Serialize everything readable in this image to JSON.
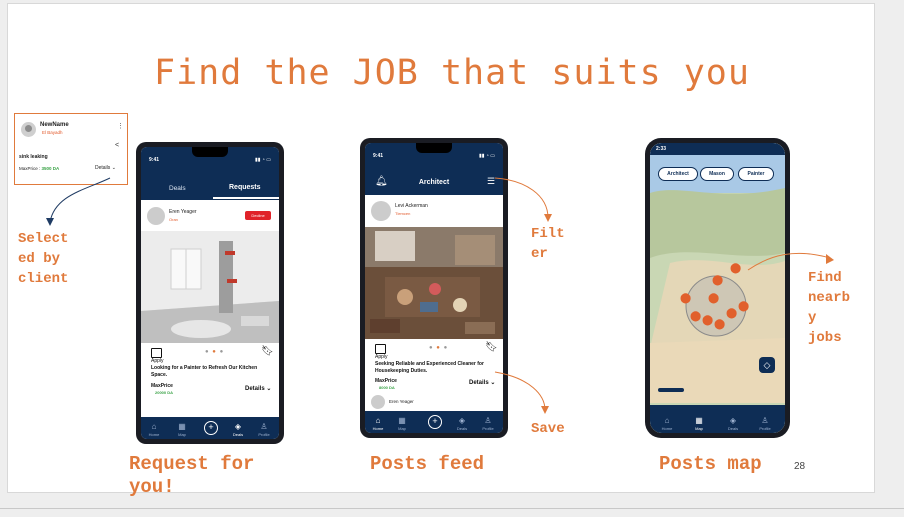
{
  "slide": {
    "title": "Find the JOB that suits you",
    "page_number": "28"
  },
  "card": {
    "name": "NewName",
    "city": "El Bayadh",
    "job": "sink leaking",
    "max_price_label": "MaxPrice :",
    "max_price_value": "3500 DA",
    "details": "Details",
    "caption": [
      "Select",
      "ed by",
      "client"
    ]
  },
  "phone1": {
    "time": "9:41",
    "tabs": [
      "Deals",
      "Requests"
    ],
    "user": "Eren Yeager",
    "user_city": "Oran",
    "decline": "Decline",
    "apply": "Apply",
    "post_text": "Looking for a Painter to Refresh Our Kitchen Space.",
    "max_price_label": "MaxPrice",
    "max_price_value": "20000 DA",
    "details": "Details",
    "nav": [
      "Home",
      "Map",
      "",
      "Deals",
      "Profile"
    ],
    "caption": [
      "Request for",
      "you!"
    ]
  },
  "phone2": {
    "time": "9:41",
    "header": "Architect",
    "user": "Levi Ackerman",
    "user_city": "Tlemcen",
    "apply": "Apply",
    "post_text": "Seeking Reliable and Experienced Cleaner for Housekeeping Duties.",
    "max_price_label": "MaxPrice",
    "max_price_value": "8000 DA",
    "details": "Details",
    "next_user": "Eren Yeager",
    "nav": [
      "Home",
      "Map",
      "",
      "Deals",
      "Profile"
    ],
    "caption": "Posts feed",
    "filter_label": [
      "Filt",
      "er"
    ],
    "save_label": "Save"
  },
  "phone3": {
    "time": "2:33",
    "chips": [
      "Architect",
      "Mason",
      "Painter"
    ],
    "nav": [
      "Home",
      "Map",
      "Deals",
      "Profile"
    ],
    "caption": "Posts map",
    "nearby_label": [
      "Find",
      "nearb",
      "y",
      "jobs"
    ]
  },
  "colors": {
    "accent": "#e07a3c",
    "navy": "#0e2d55",
    "decline_red": "#e0232a",
    "price_green": "#3aa347"
  }
}
